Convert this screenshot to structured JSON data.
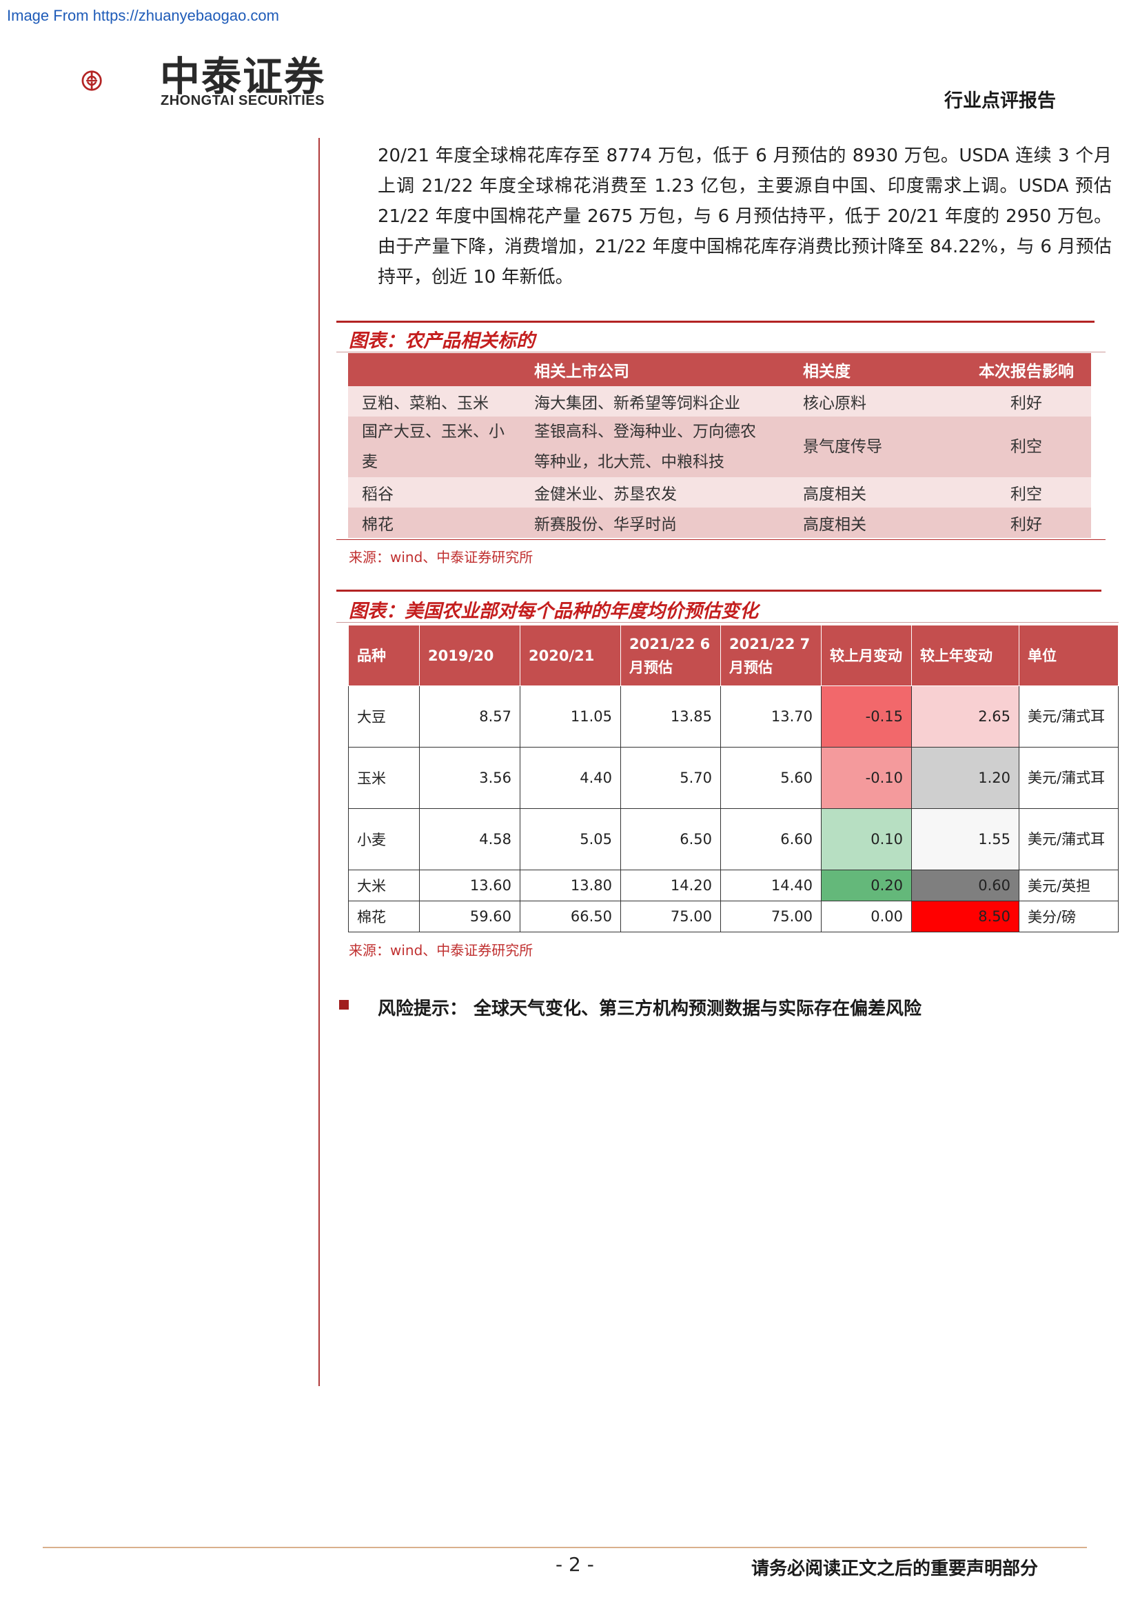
{
  "watermark": "Image From https://zhuanyebaogao.com",
  "brand": {
    "name_cn": "中泰证券",
    "name_en": "ZHONGTAI SECURITIES",
    "colors": {
      "accent": "#b32424",
      "header_fill": "#c44e4e"
    }
  },
  "header": {
    "report_type": "行业点评报告"
  },
  "body_paragraph": "20/21 年度全球棉花库存至 8774 万包，低于 6 月预估的 8930 万包。USDA 连续 3 个月上调 21/22 年度全球棉花消费至 1.23 亿包，主要源自中国、印度需求上调。USDA 预估 21/22 年度中国棉花产量 2675 万包，与 6 月预估持平，低于 20/21 年度的 2950 万包。由于产量下降，消费增加，21/22 年度中国棉花库存消费比预计降至 84.22%，与 6 月预估持平，创近 10 年新低。",
  "figure1": {
    "title": "图表：农产品相关标的",
    "headers": [
      "",
      "相关上市公司",
      "相关度",
      "本次报告影响"
    ],
    "rows": [
      {
        "product": "豆粕、菜粕、玉米",
        "companies": "海大集团、新希望等饲料企业",
        "relevance": "核心原料",
        "impact": "利好"
      },
      {
        "product": "国产大豆、玉米、小麦",
        "companies": "荃银高科、登海种业、万向德农等种业，北大荒、中粮科技",
        "relevance": "景气度传导",
        "impact": "利空"
      },
      {
        "product": "稻谷",
        "companies": "金健米业、苏垦农发",
        "relevance": "高度相关",
        "impact": "利空"
      },
      {
        "product": "棉花",
        "companies": "新赛股份、华孚时尚",
        "relevance": "高度相关",
        "impact": "利好"
      }
    ],
    "source": "来源：wind、中泰证券研究所"
  },
  "figure2": {
    "title": "图表：美国农业部对每个品种的年度均价预估变化",
    "headers": [
      "品种",
      "2019/20",
      "2020/21",
      "2021/22 6 月预估",
      "2021/22 7 月预估",
      "较上月变动",
      "较上年变动",
      "单位"
    ],
    "rows": [
      {
        "name": "大豆",
        "v1": "8.57",
        "v2": "11.05",
        "v3": "13.85",
        "v4": "13.70",
        "mom": "-0.15",
        "yoy": "2.65",
        "unit": "美元/蒲式耳",
        "mom_color": "#f2686b",
        "yoy_color": "#f8d0d2"
      },
      {
        "name": "玉米",
        "v1": "3.56",
        "v2": "4.40",
        "v3": "5.70",
        "v4": "5.60",
        "mom": "-0.10",
        "yoy": "1.20",
        "unit": "美元/蒲式耳",
        "mom_color": "#f49a9c",
        "yoy_color": "#cfcfcf"
      },
      {
        "name": "小麦",
        "v1": "4.58",
        "v2": "5.05",
        "v3": "6.50",
        "v4": "6.60",
        "mom": "0.10",
        "yoy": "1.55",
        "unit": "美元/蒲式耳",
        "mom_color": "#b7dfc2",
        "yoy_color": "#f7f7f7"
      },
      {
        "name": "大米",
        "v1": "13.60",
        "v2": "13.80",
        "v3": "14.20",
        "v4": "14.40",
        "mom": "0.20",
        "yoy": "0.60",
        "unit": "美元/英担",
        "mom_color": "#64b87a",
        "yoy_color": "#7f7f7f"
      },
      {
        "name": "棉花",
        "v1": "59.60",
        "v2": "66.50",
        "v3": "75.00",
        "v4": "75.00",
        "mom": "0.00",
        "yoy": "8.50",
        "unit": "美分/磅",
        "mom_color": "#ffffff",
        "yoy_color": "#ff0000"
      }
    ],
    "source": "来源：wind、中泰证券研究所"
  },
  "risk_note": "风险提示：  全球天气变化、第三方机构预测数据与实际存在偏差风险",
  "footer": {
    "page": "- 2 -",
    "note": "请务必阅读正文之后的重要声明部分"
  }
}
